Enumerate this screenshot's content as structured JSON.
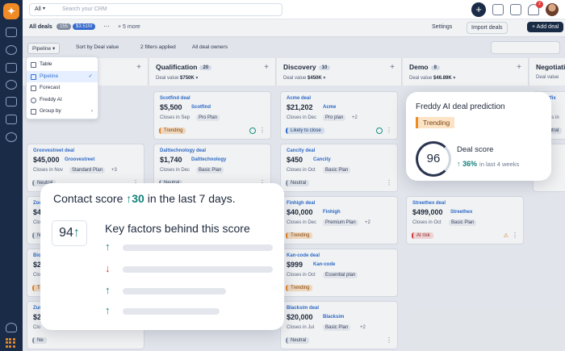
{
  "search": {
    "scope": "All",
    "placeholder": "Search your CRM"
  },
  "notifications": {
    "count": "2"
  },
  "subbar": {
    "view": "All deals",
    "deal_count": "155",
    "total": "$3.51M",
    "more": "···",
    "more_views": "+ 5 more",
    "settings": "Settings",
    "import": "Import deals",
    "add": "+ Add deal"
  },
  "filterbar": {
    "pipeline": "Pipeline",
    "sort": "Sort by Deal value",
    "filters": "2 filters applied",
    "owners": "All deal owners"
  },
  "menu": {
    "items": [
      {
        "label": "Table"
      },
      {
        "label": "Pipeline",
        "selected": true
      },
      {
        "label": "Forecast"
      },
      {
        "label": "Freddy AI"
      },
      {
        "label": "Group by"
      }
    ]
  },
  "columns": [
    {
      "name": "",
      "count": "",
      "value": ""
    },
    {
      "name": "Qualification",
      "count": "20",
      "value_label": "Deal value",
      "value": "$750K"
    },
    {
      "name": "Discovery",
      "count": "10",
      "value_label": "Deal value",
      "value": "$450K"
    },
    {
      "name": "Demo",
      "count": "8",
      "value_label": "Deal value",
      "value": "$46.89K"
    },
    {
      "name": "Negotiation",
      "count": "",
      "value_label": "Deal value",
      "value": ""
    }
  ],
  "cards": {
    "col0": [
      {
        "name": "Groovestreet deal",
        "value": "$45,000",
        "company": "Groovestreet",
        "close": "Closes in Nov",
        "plan": "Standard Plan",
        "more": "+3",
        "tag": "Neutral"
      },
      {
        "name": "Zoo",
        "value": "$4,",
        "company": "",
        "close": "Clo",
        "plan": "",
        "more": "",
        "tag": "Neu"
      },
      {
        "name": "Biop",
        "value": "$29",
        "company": "",
        "close": "Clo",
        "plan": "",
        "more": "",
        "tag": "Tre"
      },
      {
        "name": "Zum",
        "value": "$25",
        "company": "",
        "close": "Clo",
        "plan": "",
        "more": "",
        "tag": "Ne"
      }
    ],
    "col1": [
      {
        "name": "Scotfind deal",
        "value": "$5,500",
        "company": "Scotfind",
        "close": "Closes in Sep",
        "plan": "Pro Plan",
        "more": "",
        "tag": "Trending"
      },
      {
        "name": "Dalttechnology deal",
        "value": "$1,740",
        "company": "Dalttechnology",
        "close": "Closes in Dec",
        "plan": "Basic Plan",
        "more": "",
        "tag": "Neutral"
      }
    ],
    "col2": [
      {
        "name": "Acme deal",
        "value": "$21,202",
        "company": "Acme",
        "close": "Closes in Dec",
        "plan": "Pro plan",
        "more": "+2",
        "tag": "Likely to close"
      },
      {
        "name": "Cancity deal",
        "value": "$450",
        "company": "Cancity",
        "close": "Closes in Oct",
        "plan": "Basic Plan",
        "more": "",
        "tag": "Neutral"
      },
      {
        "name": "Finhigh deal",
        "value": "$40,000",
        "company": "Finhigh",
        "close": "Closes in Dec",
        "plan": "Premium Plan",
        "more": "+2",
        "tag": "Trending"
      },
      {
        "name": "Kan-code deal",
        "value": "$999",
        "company": "Kan-code",
        "close": "Closes in Oct",
        "plan": "Essential plan",
        "more": "",
        "tag": "Trending"
      },
      {
        "name": "Blacksim deal",
        "value": "$20,000",
        "company": "Blacksim",
        "close": "Closes in Jul",
        "plan": "Basic Plan",
        "more": "+2",
        "tag": "Neutral"
      }
    ],
    "col3": [
      {
        "name": "Streethex deal",
        "value": "$499,000",
        "company": "Streethex",
        "close": "Closes in Oct",
        "plan": "Basic Plan",
        "more": "",
        "tag": "At risk"
      }
    ],
    "col4": [
      {
        "name": "Stratfix deal",
        "value": "",
        "company": "",
        "close": "Closes in",
        "plan": "",
        "more": "",
        "tag": "Neutral"
      },
      {
        "name": "",
        "value": "",
        "company": "",
        "close": "",
        "plan": "",
        "more": "",
        "tag": ""
      }
    ]
  },
  "contact_score": {
    "title_pre": "Contact score",
    "change": "30",
    "title_post": "in the last 7 days.",
    "score": "94",
    "factors_title": "Key factors behind this score"
  },
  "freddy": {
    "title": "Freddy AI deal prediction",
    "tag": "Trending",
    "score": "96",
    "score_label": "Deal score",
    "pct": "36%",
    "period": "in last 4 weeks"
  },
  "colors": {
    "rail": "#1a2b47",
    "accent": "#2f6fd1",
    "teal": "#13807a",
    "orange": "#f08a24",
    "red": "#d6402f"
  }
}
